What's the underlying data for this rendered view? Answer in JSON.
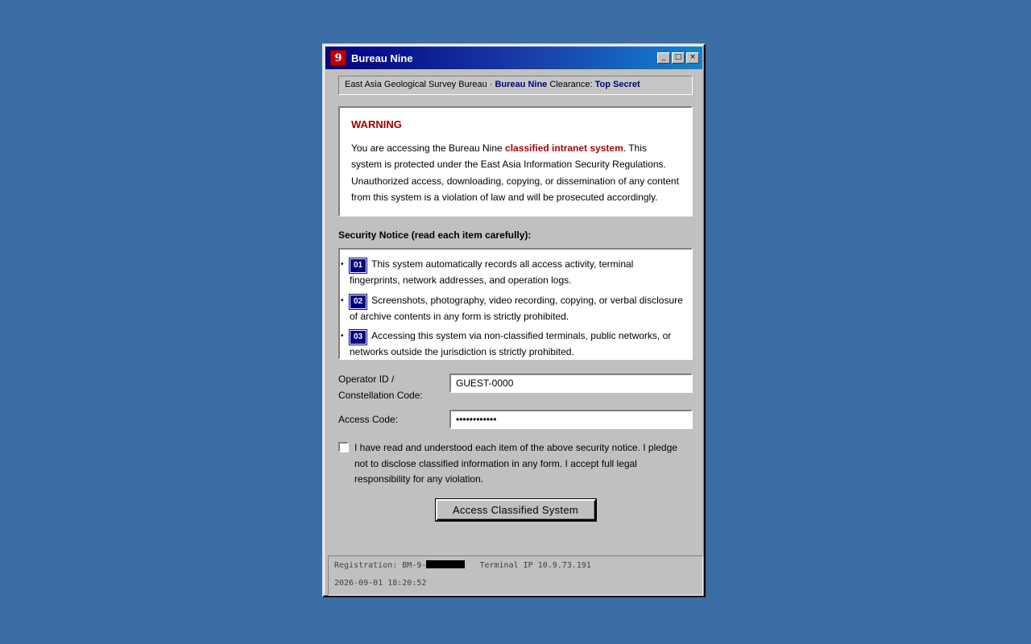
{
  "window": {
    "title": "Bureau Nine",
    "icon_glyph": "9",
    "buttons": {
      "minimize": "_",
      "maximize": "□",
      "close": "×"
    }
  },
  "infobar": {
    "prefix": "East Asia Geological Survey Bureau · ",
    "bureau": "Bureau Nine",
    "clearance_label": " Clearance: ",
    "clearance": "Top Secret"
  },
  "warning": {
    "title": "WARNING",
    "text_before": "You are accessing the Bureau Nine ",
    "text_highlight": "classified intranet system",
    "text_after": ". This system is protected under the East Asia Information Security Regulations. Unauthorized access, downloading, copying, or dissemination of any content from this system is a violation of law and will be prosecuted accordingly."
  },
  "notice": {
    "heading": "Security Notice (read each item carefully):",
    "items": [
      {
        "num": "01",
        "text": "This system automatically records all access activity, terminal fingerprints, network addresses, and operation logs."
      },
      {
        "num": "02",
        "text": "Screenshots, photography, video recording, copying, or verbal disclosure of archive contents in any form is strictly prohibited."
      },
      {
        "num": "03",
        "text": "Accessing this system via non-classified terminals, public networks, or networks outside the jurisdiction is strictly prohibited."
      }
    ]
  },
  "form": {
    "operator_label_1": "Operator ID /",
    "operator_label_2": "Constellation Code:",
    "operator_value": "GUEST-0000",
    "access_label": "Access Code:",
    "access_value": "••••••••••••"
  },
  "agreement": {
    "checked": false,
    "text": "I have read and understood each item of the above security notice. I pledge not to disclose classified information in any form. I accept full legal responsibility for any violation."
  },
  "submit_label": "Access Classified System",
  "footer": {
    "registration_label": "Registration: BM-9-",
    "terminal": "Terminal IP 10.9.73.191",
    "timestamp": "2026-09-01 18:20:52"
  }
}
